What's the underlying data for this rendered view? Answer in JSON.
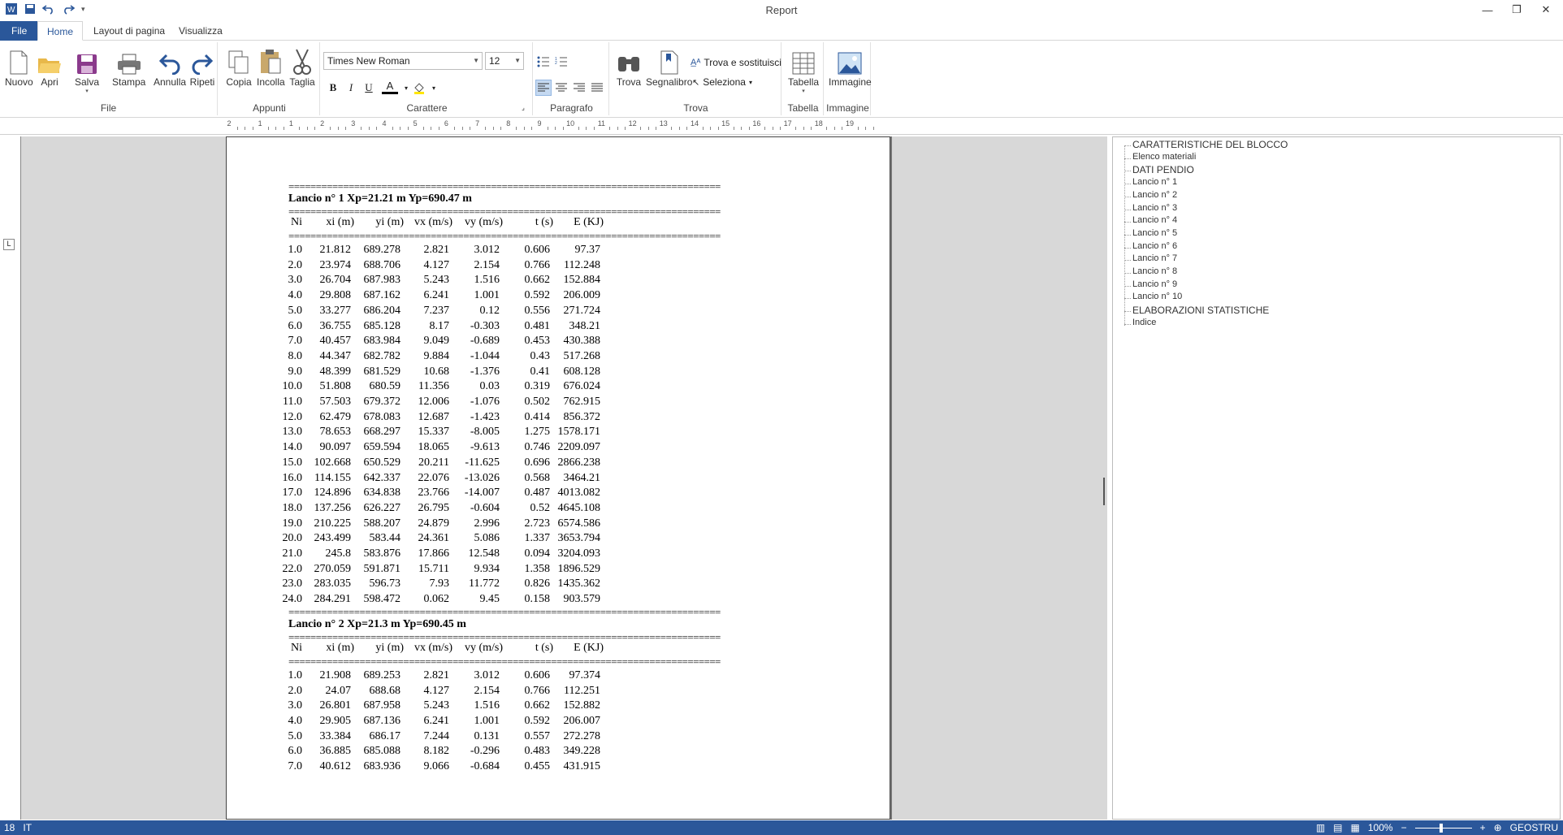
{
  "window": {
    "title": "Report",
    "minimize": "—",
    "restore": "❐",
    "close": "✕"
  },
  "tabs": [
    "File",
    "Home",
    "Layout di pagina",
    "Visualizza"
  ],
  "ribbon": {
    "file_group": {
      "label": "File",
      "nuovo": "Nuovo",
      "apri": "Apri",
      "salva": "Salva",
      "stampa": "Stampa",
      "annulla": "Annulla",
      "ripeti": "Ripeti"
    },
    "appunti": {
      "label": "Appunti",
      "copia": "Copia",
      "incolla": "Incolla",
      "taglia": "Taglia"
    },
    "carattere": {
      "label": "Carattere",
      "font": "Times New Roman",
      "size": "12",
      "bold": "B",
      "italic": "I",
      "underline": "U",
      "font_color": "A"
    },
    "paragrafo": {
      "label": "Paragrafo"
    },
    "trova": {
      "label": "Trova",
      "trova": "Trova",
      "segnalibro": "Segnalibro",
      "sostituisci": "Trova e sostituisci",
      "seleziona": "Seleziona"
    },
    "tabella": {
      "label": "Tabella",
      "tabella": "Tabella"
    },
    "immagine": {
      "label": "Immagine",
      "immagine": "Immagine"
    }
  },
  "ruler_numbers": [
    "2",
    "1",
    "1",
    "2",
    "3",
    "4",
    "5",
    "6",
    "7",
    "8",
    "9",
    "10",
    "11",
    "12",
    "13",
    "14",
    "15",
    "16",
    "17",
    "18",
    "19"
  ],
  "document": {
    "separator": "===============================================================================",
    "columns": [
      "Ni",
      "xi (m)",
      "yi (m)",
      "vx (m/s)",
      "vy (m/s)",
      "t (s)",
      "E (KJ)"
    ],
    "launch1": {
      "title": "Lancio n°    1    Xp=21.21 m     Yp=690.47 m",
      "rows": [
        [
          "1.0",
          "21.812",
          "689.278",
          "2.821",
          "3.012",
          "0.606",
          "97.37"
        ],
        [
          "2.0",
          "23.974",
          "688.706",
          "4.127",
          "2.154",
          "0.766",
          "112.248"
        ],
        [
          "3.0",
          "26.704",
          "687.983",
          "5.243",
          "1.516",
          "0.662",
          "152.884"
        ],
        [
          "4.0",
          "29.808",
          "687.162",
          "6.241",
          "1.001",
          "0.592",
          "206.009"
        ],
        [
          "5.0",
          "33.277",
          "686.204",
          "7.237",
          "0.12",
          "0.556",
          "271.724"
        ],
        [
          "6.0",
          "36.755",
          "685.128",
          "8.17",
          "-0.303",
          "0.481",
          "348.21"
        ],
        [
          "7.0",
          "40.457",
          "683.984",
          "9.049",
          "-0.689",
          "0.453",
          "430.388"
        ],
        [
          "8.0",
          "44.347",
          "682.782",
          "9.884",
          "-1.044",
          "0.43",
          "517.268"
        ],
        [
          "9.0",
          "48.399",
          "681.529",
          "10.68",
          "-1.376",
          "0.41",
          "608.128"
        ],
        [
          "10.0",
          "51.808",
          "680.59",
          "11.356",
          "0.03",
          "0.319",
          "676.024"
        ],
        [
          "11.0",
          "57.503",
          "679.372",
          "12.006",
          "-1.076",
          "0.502",
          "762.915"
        ],
        [
          "12.0",
          "62.479",
          "678.083",
          "12.687",
          "-1.423",
          "0.414",
          "856.372"
        ],
        [
          "13.0",
          "78.653",
          "668.297",
          "15.337",
          "-8.005",
          "1.275",
          "1578.171"
        ],
        [
          "14.0",
          "90.097",
          "659.594",
          "18.065",
          "-9.613",
          "0.746",
          "2209.097"
        ],
        [
          "15.0",
          "102.668",
          "650.529",
          "20.211",
          "-11.625",
          "0.696",
          "2866.238"
        ],
        [
          "16.0",
          "114.155",
          "642.337",
          "22.076",
          "-13.026",
          "0.568",
          "3464.21"
        ],
        [
          "17.0",
          "124.896",
          "634.838",
          "23.766",
          "-14.007",
          "0.487",
          "4013.082"
        ],
        [
          "18.0",
          "137.256",
          "626.227",
          "26.795",
          "-0.604",
          "0.52",
          "4645.108"
        ],
        [
          "19.0",
          "210.225",
          "588.207",
          "24.879",
          "2.996",
          "2.723",
          "6574.586"
        ],
        [
          "20.0",
          "243.499",
          "583.44",
          "24.361",
          "5.086",
          "1.337",
          "3653.794"
        ],
        [
          "21.0",
          "245.8",
          "583.876",
          "17.866",
          "12.548",
          "0.094",
          "3204.093"
        ],
        [
          "22.0",
          "270.059",
          "591.871",
          "15.711",
          "9.934",
          "1.358",
          "1896.529"
        ],
        [
          "23.0",
          "283.035",
          "596.73",
          "7.93",
          "11.772",
          "0.826",
          "1435.362"
        ],
        [
          "24.0",
          "284.291",
          "598.472",
          "0.062",
          "9.45",
          "0.158",
          "903.579"
        ]
      ]
    },
    "launch2": {
      "title": "Lancio n°    2    Xp=21.3 m     Yp=690.45 m",
      "rows": [
        [
          "1.0",
          "21.908",
          "689.253",
          "2.821",
          "3.012",
          "0.606",
          "97.374"
        ],
        [
          "2.0",
          "24.07",
          "688.68",
          "4.127",
          "2.154",
          "0.766",
          "112.251"
        ],
        [
          "3.0",
          "26.801",
          "687.958",
          "5.243",
          "1.516",
          "0.662",
          "152.882"
        ],
        [
          "4.0",
          "29.905",
          "687.136",
          "6.241",
          "1.001",
          "0.592",
          "206.007"
        ],
        [
          "5.0",
          "33.384",
          "686.17",
          "7.244",
          "0.131",
          "0.557",
          "272.278"
        ],
        [
          "6.0",
          "36.885",
          "685.088",
          "8.182",
          "-0.296",
          "0.483",
          "349.228"
        ],
        [
          "7.0",
          "40.612",
          "683.936",
          "9.066",
          "-0.684",
          "0.455",
          "431.915"
        ]
      ]
    }
  },
  "outline": [
    "CARATTERISTICHE DEL BLOCCO",
    "Elenco materiali",
    "DATI PENDIO",
    "Lancio n°     1",
    "Lancio n°     2",
    "Lancio n°     3",
    "Lancio n°     4",
    "Lancio n°     5",
    "Lancio n°     6",
    "Lancio n°     7",
    "Lancio n°     8",
    "Lancio n°     9",
    "Lancio n°     10",
    "ELABORAZIONI STATISTICHE",
    "Indice"
  ],
  "status": {
    "page": "18",
    "lang": "IT",
    "zoom": "100%",
    "user": "GEOSTRU"
  },
  "colors": {
    "accent": "#2b579a",
    "doc_bg": "#d8d8d8"
  }
}
